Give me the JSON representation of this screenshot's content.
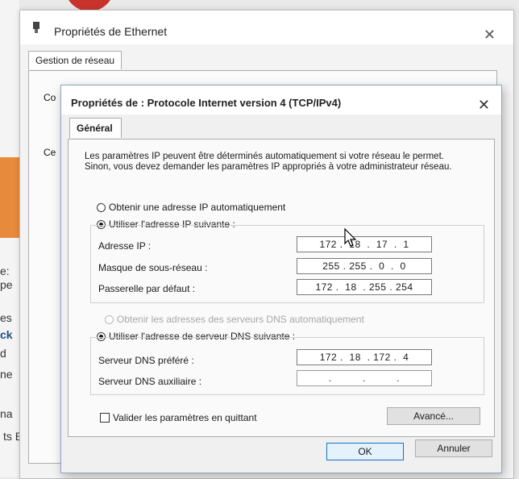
{
  "background": {
    "left_fragments": [
      "e:",
      "pe",
      "es",
      "ck",
      "d",
      "ne",
      "na"
    ],
    "bottom_fragment": "ts BPA"
  },
  "ethernet_window": {
    "title": "Propriétés de Ethernet",
    "close_icon": "close-icon",
    "tab_label": "Gestion de réseau",
    "fragments": [
      "Co",
      "Ce"
    ]
  },
  "ipv4_dialog": {
    "title": "Propriétés de : Protocole Internet version 4 (TCP/IPv4)",
    "close_icon": "close-icon",
    "tab_label": "Général",
    "description": "Les paramètres IP peuvent être déterminés automatiquement si votre réseau le permet. Sinon, vous devez demander les paramètres IP appropriés à votre administrateur réseau.",
    "ip_mode": {
      "auto_label": "Obtenir une adresse IP automatiquement",
      "manual_label": "Utiliser l'adresse IP suivante :",
      "selected": "manual"
    },
    "ip_fields": {
      "ip_address": {
        "label": "Adresse IP :",
        "value": "172 .  18  .  17  .  1"
      },
      "subnet_mask": {
        "label": "Masque de sous-réseau :",
        "value": "255 . 255 .  0  .  0"
      },
      "gateway": {
        "label": "Passerelle par défaut :",
        "value": "172 .  18  . 255 . 254"
      }
    },
    "dns_mode": {
      "auto_label": "Obtenir les adresses des serveurs DNS automatiquement",
      "manual_label": "Utiliser l'adresse de serveur DNS suivante :",
      "selected": "manual"
    },
    "dns_fields": {
      "preferred": {
        "label": "Serveur DNS préféré :",
        "value": "172 .  18  . 172 .  4"
      },
      "alternate": {
        "label": "Serveur DNS auxiliaire :",
        "value": ".          .          ."
      }
    },
    "validate_label": "Valider les paramètres en quittant",
    "validate_checked": false,
    "advanced_label": "Avancé...",
    "ok_label": "OK",
    "cancel_label": "Annuler"
  },
  "colors": {
    "accent": "#0f73c9",
    "dialog_border": "#8aa4c4",
    "disabled_text": "#a8a8a8"
  }
}
